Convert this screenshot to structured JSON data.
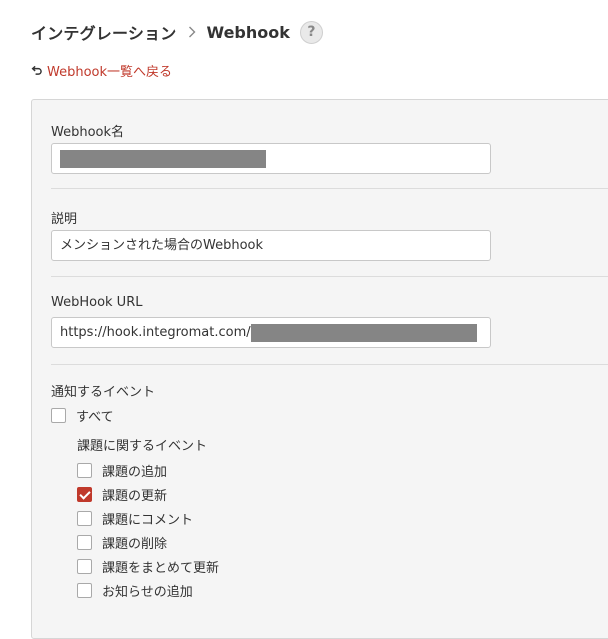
{
  "header": {
    "root": "インテグレーション",
    "current": "Webhook",
    "help": "?"
  },
  "back_link": {
    "label": "Webhook一覧へ戻る"
  },
  "form": {
    "name": {
      "label": "Webhook名",
      "value": ""
    },
    "description": {
      "label": "説明",
      "value": "メンションされた場合のWebhook"
    },
    "url": {
      "label": "WebHook URL",
      "value": "https://hook.integromat.com/"
    },
    "events": {
      "label": "通知するイベント",
      "all": {
        "label": "すべて",
        "checked": false
      },
      "issue_group": {
        "label": "課題に関するイベント",
        "items": [
          {
            "label": "課題の追加",
            "checked": false
          },
          {
            "label": "課題の更新",
            "checked": true
          },
          {
            "label": "課題にコメント",
            "checked": false
          },
          {
            "label": "課題の削除",
            "checked": false
          },
          {
            "label": "課題をまとめて更新",
            "checked": false
          },
          {
            "label": "お知らせの追加",
            "checked": false
          }
        ]
      }
    }
  },
  "colors": {
    "accent": "#c0392b",
    "panel_bg": "#f5f5f5",
    "redaction": "#858585"
  }
}
